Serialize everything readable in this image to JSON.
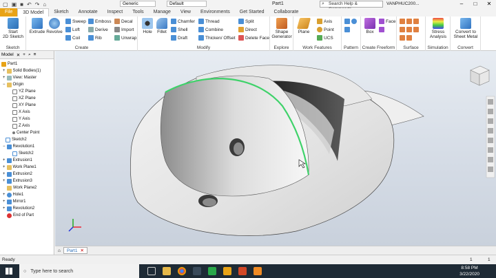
{
  "titlebar": {
    "material": "Generic",
    "appearance": "Default",
    "document_title": "Part1",
    "search_text": "Search Help & Commands...",
    "user": "VANPHUC200..."
  },
  "tabs": [
    "File",
    "3D Model",
    "Sketch",
    "Annotate",
    "Inspect",
    "Tools",
    "Manage",
    "View",
    "Environments",
    "Get Started",
    "Collaborate"
  ],
  "active_tab": "3D Model",
  "ribbon": {
    "sketch": {
      "start": "Start",
      "start2": "2D Sketch",
      "label": "Sketch"
    },
    "create": {
      "extrude": "Extrude",
      "revolve": "Revolve",
      "sweep": "Sweep",
      "loft": "Loft",
      "coil": "Coil",
      "emboss": "Emboss",
      "derive": "Derive",
      "rib": "Rib",
      "decal": "Decal",
      "import": "Import",
      "unwrap": "Unwrap",
      "label": "Create"
    },
    "modify": {
      "hole": "Hole",
      "fillet": "Fillet",
      "chamfer": "Chamfer",
      "shell": "Shell",
      "draft": "Draft",
      "thread": "Thread",
      "combine": "Combine",
      "thicken": "Thicken/ Offset",
      "split": "Split",
      "direct": "Direct",
      "delete_face": "Delete Face",
      "label": "Modify"
    },
    "explore": {
      "shape1": "Shape",
      "shape2": "Generator",
      "label": "Explore"
    },
    "work": {
      "plane": "Plane",
      "axis": "Axis",
      "point": "Point",
      "ucs": "UCS",
      "label": "Work Features"
    },
    "pattern": {
      "label": "Pattern"
    },
    "freeform": {
      "box": "Box",
      "face": "Face",
      "label": "Create Freeform"
    },
    "surface": {
      "label": "Surface"
    },
    "simulation": {
      "stress1": "Stress",
      "stress2": "Analysis",
      "label": "Simulation"
    },
    "convert": {
      "c1": "Convert to",
      "c2": "Sheet Metal",
      "label": "Convert"
    }
  },
  "browser": {
    "title": "Model",
    "items": [
      "Part1",
      "Solid Bodies(1)",
      "View: Master",
      "Origin",
      "YZ Plane",
      "XZ Plane",
      "XY Plane",
      "X Axis",
      "Y Axis",
      "Z Axis",
      "Center Point",
      "Sketch2",
      "Revolution1",
      "Sketch2",
      "Extrusion1",
      "Work Plane1",
      "Extrusion2",
      "Extrusion3",
      "Work Plane2",
      "Hole1",
      "Mirror1",
      "Revolution2",
      "End of Part"
    ]
  },
  "doc_tab": "Part1",
  "status": {
    "text": "Ready",
    "n1": "1",
    "n2": "1"
  },
  "taskbar": {
    "search_placeholder": "Type here to search",
    "time": "8:58 PM",
    "date": "3/22/2020"
  },
  "colors": {
    "file_tab": "#e8a317",
    "edge_highlight": "#3fd26a",
    "taskbar": "#1e2a35"
  }
}
